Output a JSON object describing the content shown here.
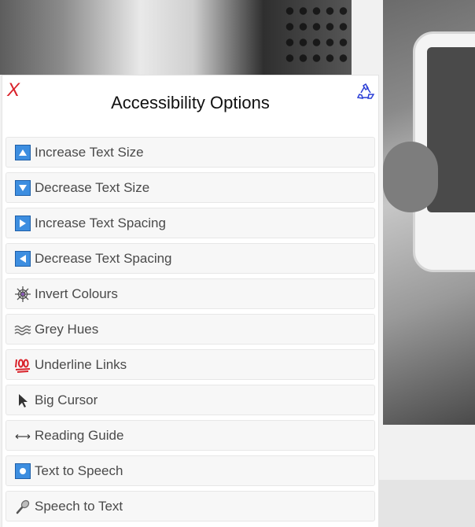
{
  "panel": {
    "title": "Accessibility Options",
    "close_label": "X"
  },
  "options": [
    {
      "label": "Increase Text Size",
      "icon": "arrow-up-square-icon"
    },
    {
      "label": "Decrease Text Size",
      "icon": "arrow-down-square-icon"
    },
    {
      "label": "Increase Text Spacing",
      "icon": "arrow-right-square-icon"
    },
    {
      "label": "Decrease Text Spacing",
      "icon": "arrow-left-square-icon"
    },
    {
      "label": "Invert Colours",
      "icon": "spider-web-icon"
    },
    {
      "label": "Grey Hues",
      "icon": "waves-icon"
    },
    {
      "label": "Underline Links",
      "icon": "hundred-points-icon"
    },
    {
      "label": "Big Cursor",
      "icon": "cursor-arrow-icon"
    },
    {
      "label": "Reading Guide",
      "icon": "left-right-arrow-icon"
    },
    {
      "label": "Text to Speech",
      "icon": "record-button-icon"
    },
    {
      "label": "Speech to Text",
      "icon": "microphone-icon"
    }
  ],
  "colors": {
    "close": "#d9222a",
    "icon_square": "#3d8ee0",
    "reset_icon": "#2b3fd6"
  }
}
